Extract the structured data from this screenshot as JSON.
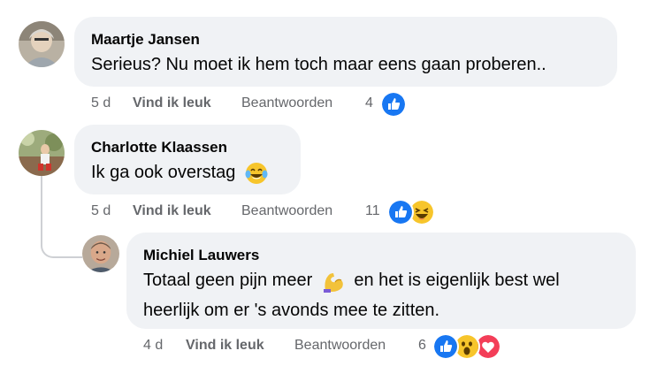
{
  "comments": [
    {
      "author": "Maartje Jansen",
      "text": "Serieus? Nu moet ik hem toch maar eens gaan proberen..",
      "time": "5 d",
      "like_label": "Vind ik leuk",
      "reply_label": "Beantwoorden",
      "reaction_count": "4",
      "reactions": [
        "like-icon"
      ]
    },
    {
      "author": "Charlotte Klaassen",
      "text": "Ik ga ook overstag",
      "text_emoji": "tears-of-joy-emoji",
      "time": "5 d",
      "like_label": "Vind ik leuk",
      "reply_label": "Beantwoorden",
      "reaction_count": "11",
      "reactions": [
        "like-icon",
        "haha-icon"
      ]
    },
    {
      "author": "Michiel Lauwers",
      "text_line1_a": "Totaal geen pijn meer",
      "text_emoji": "flexed-biceps-emoji",
      "text_line1_b": "en het is eigenlijk best wel",
      "text_line2": "heerlijk om er 's avonds mee te zitten.",
      "time": "4 d",
      "like_label": "Vind ik leuk",
      "reply_label": "Beantwoorden",
      "reaction_count": "6",
      "reactions": [
        "like-icon",
        "wow-icon",
        "love-icon"
      ]
    }
  ],
  "colors": {
    "bubble": "#f0f2f5",
    "meta_text": "#65676b",
    "like_blue": "#1877f2",
    "love_red": "#f33e58",
    "emoji_yellow": "#f7c52b"
  }
}
